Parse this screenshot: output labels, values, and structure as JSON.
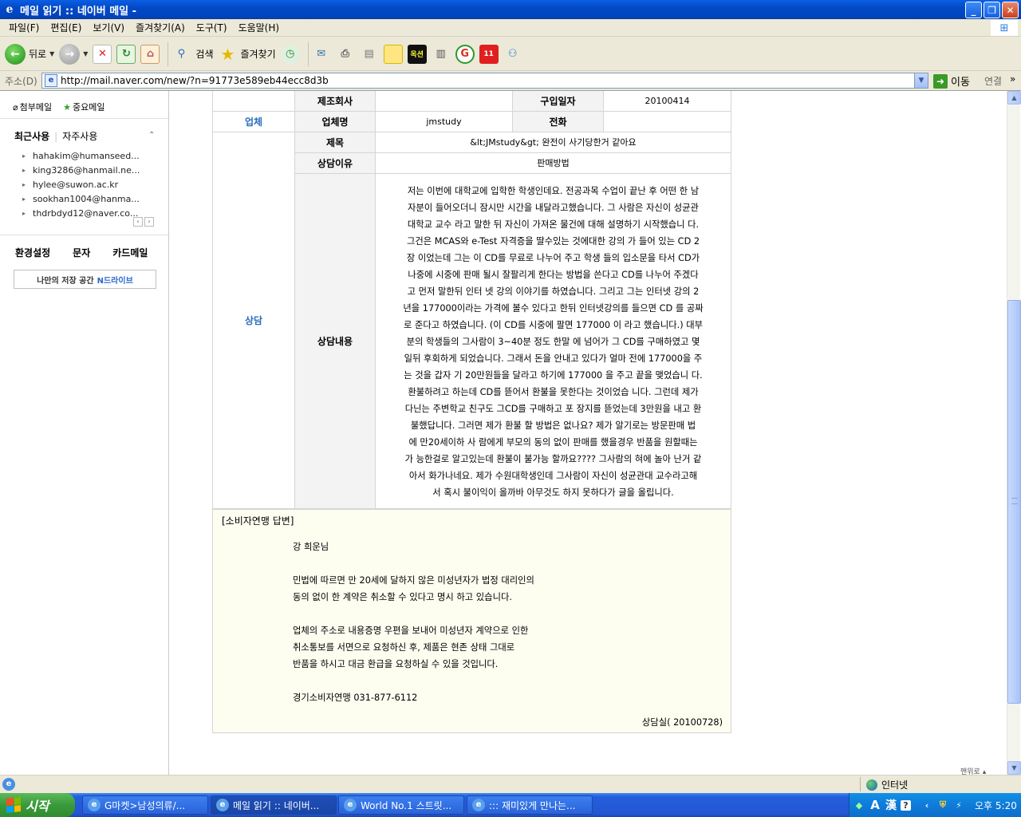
{
  "window": {
    "title": "메일 읽기 :: 네이버 메일 -",
    "buttons": {
      "minimize": "_",
      "maximize": "❐",
      "close": "✕"
    }
  },
  "menu": [
    "파일(F)",
    "편집(E)",
    "보기(V)",
    "즐겨찾기(A)",
    "도구(T)",
    "도움말(H)"
  ],
  "toolbar": {
    "back_label": "뒤로",
    "search_label": "검색",
    "favorites_label": "즐겨찾기"
  },
  "address": {
    "label": "주소(D)",
    "url": "http://mail.naver.com/new/?n=91773e589eb44ecc8d3b",
    "go_label": "이동",
    "links_label": "연결"
  },
  "sidebar": {
    "attach_mail": "첨부메일",
    "important_mail": "중요메일",
    "tab_recent": "최근사용",
    "tab_frequent": "자주사용",
    "contacts": [
      "hahakim@humanseed...",
      "king3286@hanmail.ne...",
      "hylee@suwon.ac.kr",
      "sookhan1004@hanma...",
      "thdrbdyd12@naver.co..."
    ],
    "menu": [
      "환경설정",
      "문자",
      "카드메일"
    ],
    "ndrive_text": "나만의 저장 공간",
    "ndrive_brand": "N드라이브"
  },
  "inquiry": {
    "rows": {
      "maker_label": "제조회사",
      "maker_value": "",
      "purchase_date_label": "구입일자",
      "purchase_date": "20100414",
      "company_section": "업체",
      "company_name_label": "업체명",
      "company_name": "jmstudy",
      "phone_label": "전화",
      "phone": "",
      "consult_section": "상담",
      "subject_label": "제목",
      "subject": "&lt;JMstudy&gt; 완전이 사기당한거 같아요",
      "reason_label": "상담이유",
      "reason": "판매방법",
      "content_label": "상담내용",
      "content_lines": [
        "저는 이번에 대학교에 입학한 학생인데요. 전공과목 수업이 끝난 후 어떤 한 남",
        "자분이 들어오더니 잠시만 시간을 내달라고했습니다. 그 사람은 자신이 성균관",
        "대학교 교수 라고 말한 뒤 자신이 가져온 물건에 대해 설명하기 시작했습니 다.",
        "그건은 MCAS와 e-Test 자격증을 딸수있는 것에대한 강의 가 들어 있는 CD 2",
        "장 이었는데 그는 이 CD를 무료로 나누어 주고 학생 들의 입소문을 타서 CD가",
        "나중에 시중에 판매 될시 잘팔리게 한다는 방법을 쓴다고 CD를 나누어 주겠다",
        "고 먼저 말한뒤 인터 넷 강의 이야기를 하였습니다. 그리고 그는 인터넷 강의 2",
        "년을 177000이라는 가격에 볼수 있다고 한뒤 인터넷강의를 들으면 CD 를 공짜",
        "로 준다고 하였습니다. (이 CD를 시중에 팔면 177000 이 라고 했습니다.) 대부",
        "분의 학생들의 그사람이 3~40분 정도 한말 에 넘어가 그 CD를 구매하였고 몇",
        "일뒤 후회하게 되었습니다. 그래서 돈을 안내고 있다가 얼마 전에 177000을 주",
        "는 것을 갑자 기 20만원들을 달라고 하기에 177000 을 주고 끝을 맺었습니 다.",
        "환불하려고 하는데 CD를 뜯어서 환불을 못한다는 것이었습 니다. 그런데 제가",
        "다닌는 주변학교 친구도 그CD를 구매하고 포 장지를 뜯었는데 3만원을 내고 환",
        "불했답니다. 그러면 제가 환불 할 방법은 없나요? 제가 알기로는 방문판매 법",
        "에 만20세이하 사 람에게 부모의 동의 없이 판매를 했을경우 반품을 원할때는",
        "가 능한걸로 알고있는데 환불이 불가능 할까요???? 그사람의 혀에 놀아 난거 같",
        "아서 화가나네요. 제가 수원대학생인데 그사람이 자신이 성균관대 교수라고해",
        "서 혹시 불이익이 올까바 아무것도 하지 못하다가 글을 올립니다."
      ]
    }
  },
  "answer": {
    "header": "[소비자연맹 답변]",
    "greeting": "강 희운님",
    "para1": [
      "민법에 따르면 만 20세에 달하지 않은 미성년자가 법정 대리인의",
      "동의 없이 한 계약은 취소할 수 있다고 명시 하고 있습니다."
    ],
    "para2": [
      "업체의 주소로 내용증명 우편을 보내어 미성년자 계약으로 인한",
      "취소통보를 서면으로 요청하신 후, 제품은 현존 상태 그대로",
      "반품을 하시고 대금 환급을 요청하실 수 있을 것입니다."
    ],
    "signature": "경기소비자연맹 031-877-6112",
    "footer": "상담실( 20100728)"
  },
  "page_bottom_tag": "맨위로",
  "status": {
    "zone": "인터넷"
  },
  "taskbar": {
    "start": "시작",
    "tasks": [
      "G마켓>남성의류/...",
      "메일 읽기 :: 네이버...",
      "World No.1 스트릿...",
      "::: 재미있게 만나는..."
    ],
    "clock": "오후 5:20"
  }
}
